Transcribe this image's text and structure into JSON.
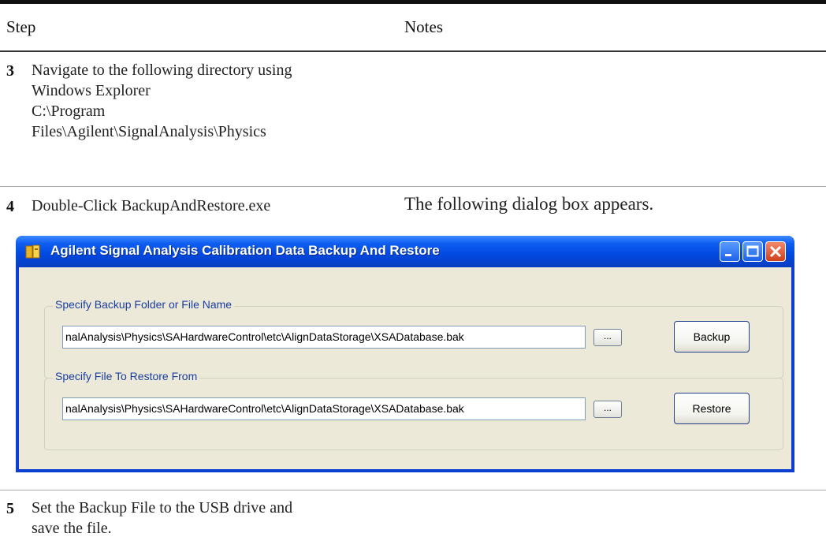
{
  "table": {
    "headers": {
      "step": "Step",
      "notes": "Notes"
    },
    "steps": [
      {
        "number": "3",
        "lines": [
          "Navigate to the following directory using",
          "Windows Explorer",
          "C:\\Program",
          "Files\\Agilent\\SignalAnalysis\\Physics"
        ],
        "note": ""
      },
      {
        "number": "4",
        "lines": [
          "Double-Click BackupAndRestore.exe"
        ],
        "note": "The following dialog box appears."
      },
      {
        "number": "5",
        "lines": [
          "Set the Backup File to the USB drive and",
          "save the file."
        ],
        "note": ""
      }
    ]
  },
  "dialog": {
    "title": "Agilent Signal Analysis Calibration Data Backup And Restore",
    "icon": "app-icon",
    "window_controls": [
      "minimize-icon",
      "maximize-icon",
      "close-icon"
    ],
    "backup_group": {
      "legend": "Specify Backup Folder or File Name",
      "path_value": "nalAnalysis\\Physics\\SAHardwareControl\\etc\\AlignDataStorage\\XSADatabase.bak",
      "browse_label": "...",
      "button_label": "Backup"
    },
    "restore_group": {
      "legend": "Specify File To Restore From",
      "path_value": "nalAnalysis\\Physics\\SAHardwareControl\\etc\\AlignDataStorage\\XSADatabase.bak",
      "browse_label": "...",
      "button_label": "Restore"
    }
  },
  "colors": {
    "title_bar": "#0048e0",
    "dialog_face": "#ece9d8",
    "group_legend": "#1a3ea0"
  }
}
